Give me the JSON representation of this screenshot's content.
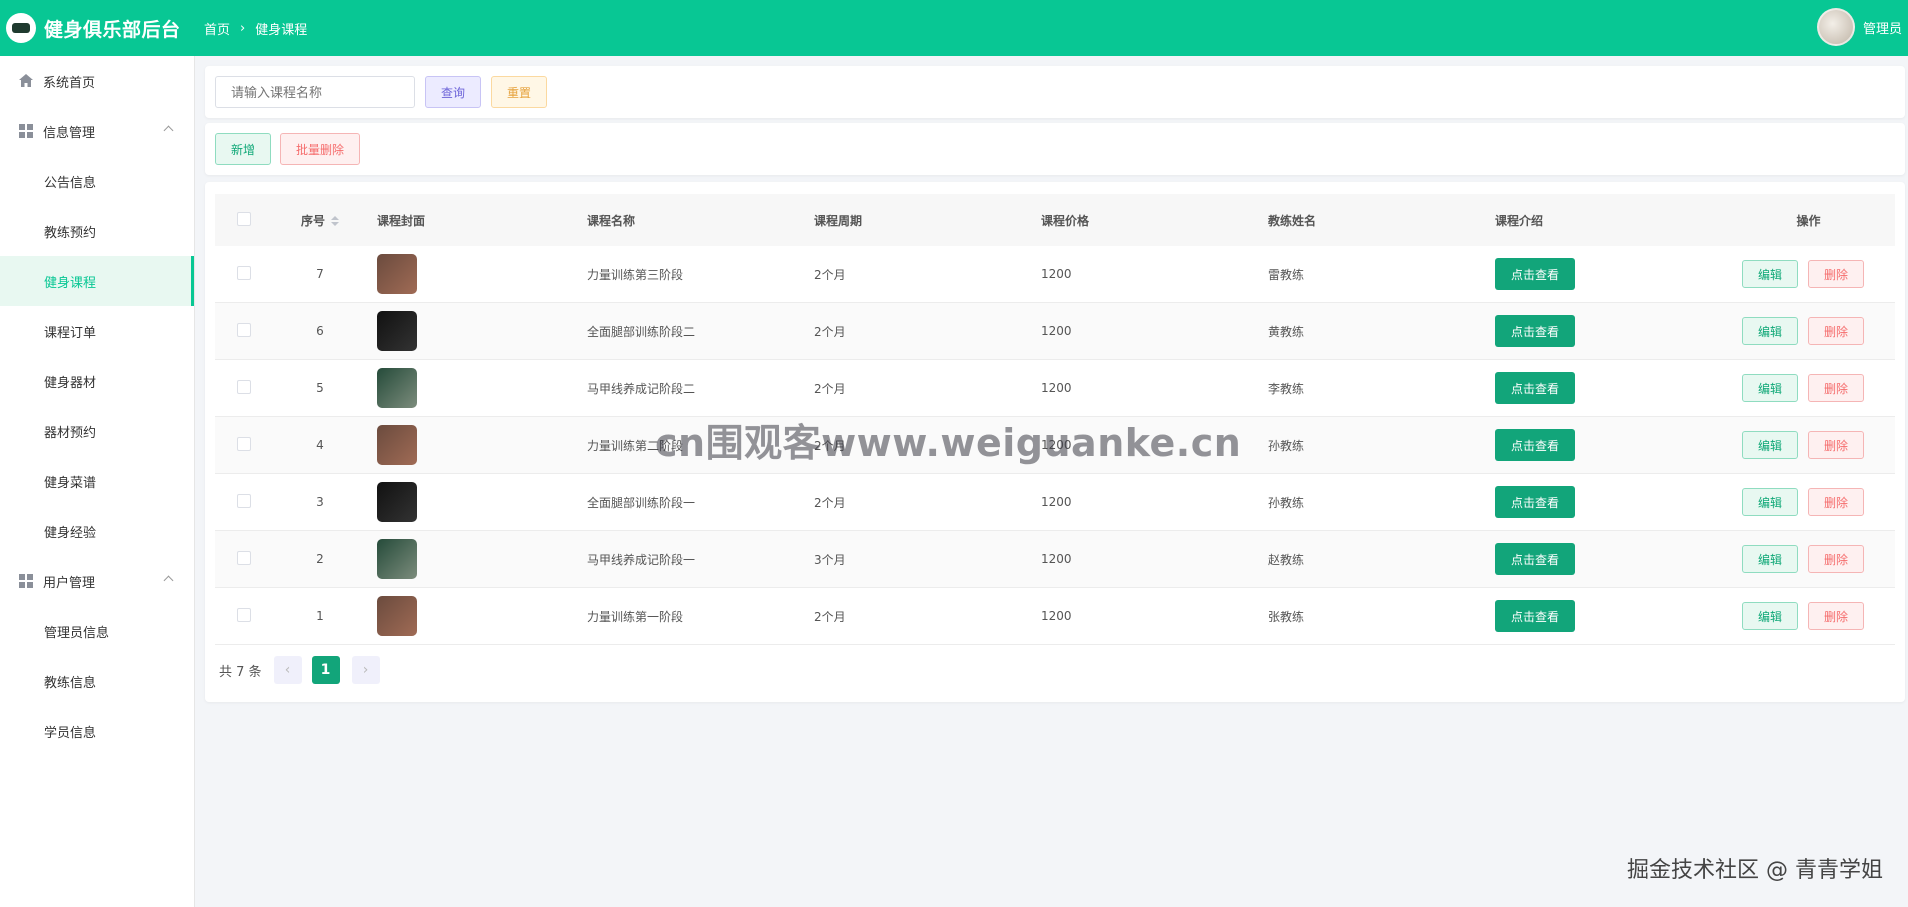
{
  "header": {
    "app_title": "健身俱乐部后台",
    "breadcrumb": [
      "首页",
      "健身课程"
    ],
    "username": "管理员",
    "bg_color": "#08c794"
  },
  "sidebar": {
    "items": [
      {
        "label": "系统首页",
        "type": "item",
        "icon": "home-icon"
      },
      {
        "label": "信息管理",
        "type": "group",
        "icon": "grid-icon"
      },
      {
        "label": "公告信息",
        "type": "sub"
      },
      {
        "label": "教练预约",
        "type": "sub"
      },
      {
        "label": "健身课程",
        "type": "sub",
        "active": true
      },
      {
        "label": "课程订单",
        "type": "sub"
      },
      {
        "label": "健身器材",
        "type": "sub"
      },
      {
        "label": "器材预约",
        "type": "sub"
      },
      {
        "label": "健身菜谱",
        "type": "sub"
      },
      {
        "label": "健身经验",
        "type": "sub"
      },
      {
        "label": "用户管理",
        "type": "group",
        "icon": "grid-icon"
      },
      {
        "label": "管理员信息",
        "type": "sub"
      },
      {
        "label": "教练信息",
        "type": "sub"
      },
      {
        "label": "学员信息",
        "type": "sub"
      }
    ]
  },
  "search": {
    "placeholder": "请输入课程名称",
    "query_label": "查询",
    "reset_label": "重置"
  },
  "actions": {
    "add_label": "新增",
    "batch_delete_label": "批量删除"
  },
  "table": {
    "headers": {
      "id": "序号",
      "cover": "课程封面",
      "name": "课程名称",
      "period": "课程周期",
      "price": "课程价格",
      "coach": "教练姓名",
      "intro": "课程介绍",
      "ops": "操作"
    },
    "view_label": "点击查看",
    "edit_label": "编辑",
    "delete_label": "删除",
    "rows": [
      {
        "id": "7",
        "cover": "brown",
        "name": "力量训练第三阶段",
        "period": "2个月",
        "price": "1200",
        "coach": "雷教练"
      },
      {
        "id": "6",
        "cover": "black",
        "name": "全面腿部训练阶段二",
        "period": "2个月",
        "price": "1200",
        "coach": "黄教练"
      },
      {
        "id": "5",
        "cover": "green",
        "name": "马甲线养成记阶段二",
        "period": "2个月",
        "price": "1200",
        "coach": "李教练"
      },
      {
        "id": "4",
        "cover": "brown",
        "name": "力量训练第二阶段",
        "period": "2个月",
        "price": "1200",
        "coach": "孙教练"
      },
      {
        "id": "3",
        "cover": "black",
        "name": "全面腿部训练阶段一",
        "period": "2个月",
        "price": "1200",
        "coach": "孙教练"
      },
      {
        "id": "2",
        "cover": "green",
        "name": "马甲线养成记阶段一",
        "period": "3个月",
        "price": "1200",
        "coach": "赵教练"
      },
      {
        "id": "1",
        "cover": "brown",
        "name": "力量训练第一阶段",
        "period": "2个月",
        "price": "1200",
        "coach": "张教练"
      }
    ]
  },
  "pagination": {
    "total_text": "共 7 条",
    "current_page": "1"
  },
  "watermark": "cn围观客www.weiguanke.cn",
  "credit": "掘金技术社区 @ 青青学姐"
}
